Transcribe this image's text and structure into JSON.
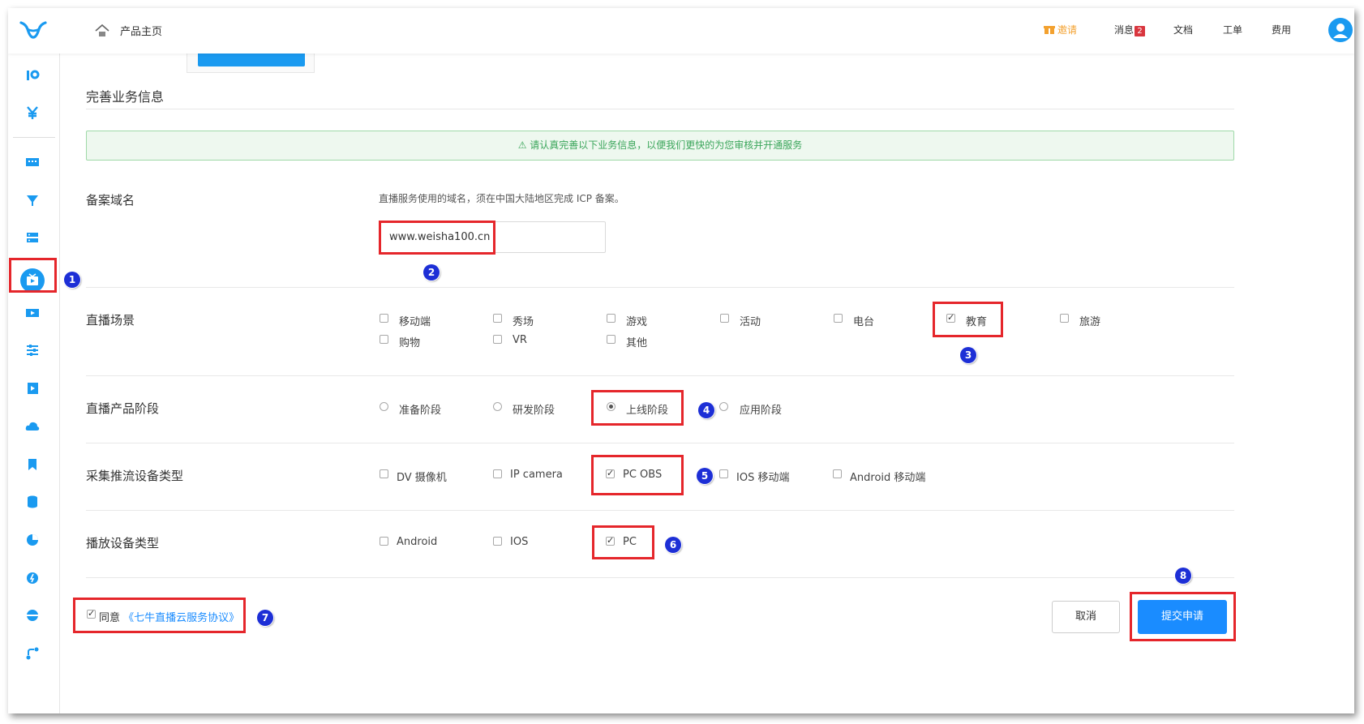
{
  "header": {
    "home_label": "产品主页",
    "invite_label": "邀请",
    "messages_label": "消息",
    "messages_count": "2",
    "docs_label": "文档",
    "tickets_label": "工单",
    "billing_label": "费用"
  },
  "form": {
    "section_title": "完善业务信息",
    "alert": "请认真完善以下业务信息，以便我们更快的为您审核并开通服务",
    "domain": {
      "label": "备案域名",
      "hint": "直播服务使用的域名，须在中国大陆地区完成 ICP 备案。",
      "value": "www.weisha100.cn"
    },
    "scenario": {
      "label": "直播场景",
      "options": [
        {
          "label": "移动端",
          "checked": false
        },
        {
          "label": "秀场",
          "checked": false
        },
        {
          "label": "游戏",
          "checked": false
        },
        {
          "label": "活动",
          "checked": false
        },
        {
          "label": "电台",
          "checked": false
        },
        {
          "label": "教育",
          "checked": true
        },
        {
          "label": "旅游",
          "checked": false
        },
        {
          "label": "购物",
          "checked": false
        },
        {
          "label": "VR",
          "checked": false
        },
        {
          "label": "其他",
          "checked": false
        }
      ]
    },
    "stage": {
      "label": "直播产品阶段",
      "options": [
        {
          "label": "准备阶段",
          "checked": false
        },
        {
          "label": "研发阶段",
          "checked": false
        },
        {
          "label": "上线阶段",
          "checked": true
        },
        {
          "label": "应用阶段",
          "checked": false
        }
      ]
    },
    "capture": {
      "label": "采集推流设备类型",
      "options": [
        {
          "label": "DV 摄像机",
          "checked": false
        },
        {
          "label": "IP camera",
          "checked": false
        },
        {
          "label": "PC OBS",
          "checked": true
        },
        {
          "label": "IOS 移动端",
          "checked": false
        },
        {
          "label": "Android 移动端",
          "checked": false
        }
      ]
    },
    "playback": {
      "label": "播放设备类型",
      "options": [
        {
          "label": "Android",
          "checked": false
        },
        {
          "label": "IOS",
          "checked": false
        },
        {
          "label": "PC",
          "checked": true
        }
      ]
    },
    "agree_label": "同意",
    "agree_link": "《七牛直播云服务协议》",
    "agree_checked": true,
    "cancel_label": "取消",
    "submit_label": "提交申请"
  },
  "markers": [
    "1",
    "2",
    "3",
    "4",
    "5",
    "6",
    "7",
    "8"
  ],
  "colors": {
    "accent": "#1a8cff",
    "highlight": "#e5262b",
    "marker": "#1d2fd6",
    "alert_text": "#3aa55a"
  }
}
